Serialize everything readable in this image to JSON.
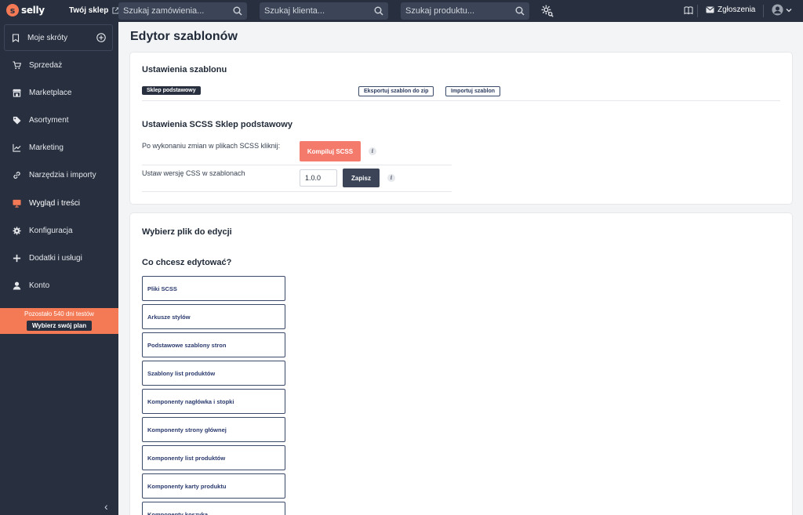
{
  "topbar": {
    "logo_mark": "s",
    "logo_text": "selly",
    "shop_link": "Twój sklep",
    "search_orders_placeholder": "Szukaj zamówienia...",
    "search_clients_placeholder": "Szukaj klienta...",
    "search_products_placeholder": "Szukaj produktu...",
    "reports_label": "Zgłoszenia"
  },
  "sidebar": {
    "shortcuts_label": "Moje skróty",
    "items": [
      {
        "label": "Sprzedaż",
        "icon": "cart-icon"
      },
      {
        "label": "Marketplace",
        "icon": "store-icon"
      },
      {
        "label": "Asortyment",
        "icon": "tag-icon"
      },
      {
        "label": "Marketing",
        "icon": "chart-icon"
      },
      {
        "label": "Narzędzia i importy",
        "icon": "link-icon"
      },
      {
        "label": "Wygląd i treści",
        "icon": "monitor-icon"
      },
      {
        "label": "Konfiguracja",
        "icon": "gear-icon"
      },
      {
        "label": "Dodatki i usługi",
        "icon": "plus-icon"
      },
      {
        "label": "Konto",
        "icon": "user-icon"
      }
    ],
    "trial_text": "Pozostało 540 dni testów",
    "trial_button": "Wybierz swój plan",
    "collapse_glyph": "‹",
    "active_color": "#f47a56"
  },
  "main": {
    "page_title": "Edytor szablonów",
    "template_settings": {
      "title": "Ustawienia szablonu",
      "badge": "Sklep podstawowy",
      "export_button": "Eksportuj szablon do zip",
      "import_button": "Importuj szablon"
    },
    "scss_settings": {
      "title": "Ustawienia SCSS Sklep podstawowy",
      "compile_label": "Po wykonaniu zmian w plikach SCSS kliknij:",
      "compile_button": "Kompiluj SCSS",
      "version_label": "Ustaw wersję CSS w szablonach",
      "version_value": "1.0.0",
      "save_button": "Zapisz",
      "info_glyph": "i"
    },
    "file_picker": {
      "title": "Wybierz plik do edycji",
      "question": "Co chcesz edytować?",
      "items": [
        "Pliki SCSS",
        "Arkusze stylów",
        "Podstawowe szablony stron",
        "Szablony list produktów",
        "Komponenty nagłówka i stopki",
        "Komponenty strony głównej",
        "Komponenty list produktów",
        "Komponenty karty produktu",
        "Komponenty koszyka"
      ]
    }
  },
  "colors": {
    "sidebar_bg": "#283040",
    "accent": "#f47a56",
    "coral_button": "#f47a6b"
  }
}
